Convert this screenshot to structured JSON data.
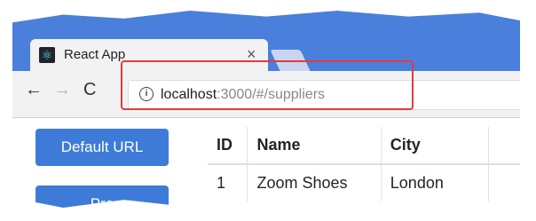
{
  "browser": {
    "tab_title": "React App",
    "tab_close": "×",
    "url_host": "localhost",
    "url_rest": ":3000/#/suppliers",
    "back_icon": "arrow-left-icon",
    "forward_icon": "arrow-right-icon",
    "reload_icon": "reload-icon",
    "info_icon": "info-icon",
    "highlight_color": "#e23b3b"
  },
  "nav_buttons": {
    "default_url": "Default URL",
    "second": "Pro"
  },
  "table": {
    "headers": [
      "ID",
      "Name",
      "City",
      ""
    ],
    "rows": [
      [
        "1",
        "Zoom Shoes",
        "London",
        ""
      ]
    ]
  },
  "colors": {
    "chrome": "#4a7fdc",
    "button": "#3e7bd8"
  }
}
